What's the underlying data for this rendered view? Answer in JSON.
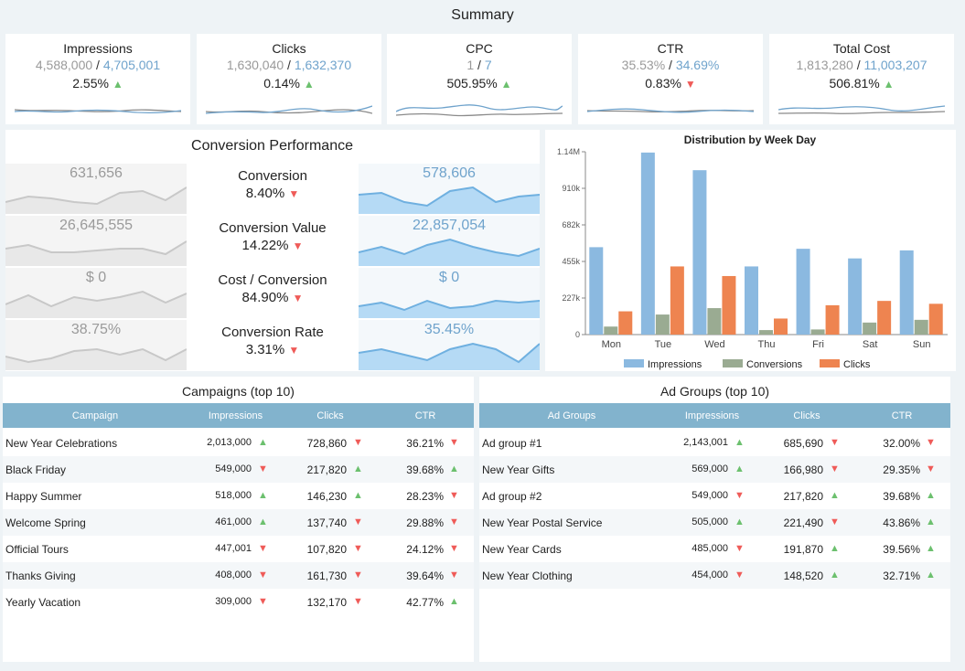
{
  "page_title": "Summary",
  "kpis": [
    {
      "name": "Impressions",
      "prev": "4,588,000",
      "cur": "4,705,001",
      "pct": "2.55%",
      "dir": "up"
    },
    {
      "name": "Clicks",
      "prev": "1,630,040",
      "cur": "1,632,370",
      "pct": "0.14%",
      "dir": "up"
    },
    {
      "name": "CPC",
      "prev": "1",
      "cur": "7",
      "pct": "505.95%",
      "dir": "up"
    },
    {
      "name": "CTR",
      "prev": "35.53%",
      "cur": "34.69%",
      "pct": "0.83%",
      "dir": "down"
    },
    {
      "name": "Total Cost",
      "prev": "1,813,280",
      "cur": "11,003,207",
      "pct": "506.81%",
      "dir": "up"
    }
  ],
  "separator": "/",
  "conversion": {
    "title": "Conversion Performance",
    "rows": [
      {
        "name": "Conversion",
        "left": "631,656",
        "pct": "8.40%",
        "dir": "down",
        "right": "578,606"
      },
      {
        "name": "Conversion Value",
        "left": "26,645,555",
        "pct": "14.22%",
        "dir": "down",
        "right": "22,857,054"
      },
      {
        "name": "Cost / Conversion",
        "left": "$ 0",
        "pct": "84.90%",
        "dir": "down",
        "right": "$ 0"
      },
      {
        "name": "Conversion Rate",
        "left": "38.75%",
        "pct": "3.31%",
        "dir": "down",
        "right": "35.45%"
      }
    ]
  },
  "chart_data": {
    "type": "bar",
    "title": "Distribution by Week Day",
    "categories": [
      "Mon",
      "Tue",
      "Wed",
      "Thu",
      "Fri",
      "Sat",
      "Sun"
    ],
    "series": [
      {
        "name": "Impressions",
        "color": "#8bb9e0",
        "values": [
          545000,
          1135000,
          1025000,
          425000,
          535000,
          475000,
          525000
        ]
      },
      {
        "name": "Conversions",
        "color": "#9aab92",
        "values": [
          50000,
          125000,
          165000,
          28000,
          32000,
          75000,
          92000
        ]
      },
      {
        "name": "Clicks",
        "color": "#ee8450",
        "values": [
          145000,
          425000,
          365000,
          100000,
          183000,
          210000,
          192000
        ]
      }
    ],
    "yticks": [
      "0",
      "227k",
      "455k",
      "682k",
      "910k",
      "1.14M"
    ],
    "ylim": [
      0,
      1140000
    ],
    "legend": "bottom"
  },
  "campaigns": {
    "title": "Campaigns (top 10)",
    "headers": [
      "Campaign",
      "Impressions",
      "Clicks",
      "CTR"
    ],
    "rows": [
      {
        "name": "New Year Celebrations",
        "imp": "2,013,000",
        "imp_dir": "up",
        "clicks": "728,860",
        "clicks_dir": "down",
        "ctr": "36.21%",
        "ctr_dir": "down"
      },
      {
        "name": "Black Friday",
        "imp": "549,000",
        "imp_dir": "down",
        "clicks": "217,820",
        "clicks_dir": "up",
        "ctr": "39.68%",
        "ctr_dir": "up"
      },
      {
        "name": "Happy Summer",
        "imp": "518,000",
        "imp_dir": "up",
        "clicks": "146,230",
        "clicks_dir": "up",
        "ctr": "28.23%",
        "ctr_dir": "down"
      },
      {
        "name": "Welcome Spring",
        "imp": "461,000",
        "imp_dir": "up",
        "clicks": "137,740",
        "clicks_dir": "down",
        "ctr": "29.88%",
        "ctr_dir": "down"
      },
      {
        "name": "Official Tours",
        "imp": "447,001",
        "imp_dir": "down",
        "clicks": "107,820",
        "clicks_dir": "down",
        "ctr": "24.12%",
        "ctr_dir": "down"
      },
      {
        "name": "Thanks Giving",
        "imp": "408,000",
        "imp_dir": "down",
        "clicks": "161,730",
        "clicks_dir": "down",
        "ctr": "39.64%",
        "ctr_dir": "down"
      },
      {
        "name": "Yearly Vacation",
        "imp": "309,000",
        "imp_dir": "down",
        "clicks": "132,170",
        "clicks_dir": "down",
        "ctr": "42.77%",
        "ctr_dir": "up"
      }
    ]
  },
  "adgroups": {
    "title": "Ad Groups (top 10)",
    "headers": [
      "Ad Groups",
      "Impressions",
      "Clicks",
      "CTR"
    ],
    "rows": [
      {
        "name": "Ad group #1",
        "imp": "2,143,001",
        "imp_dir": "up",
        "clicks": "685,690",
        "clicks_dir": "down",
        "ctr": "32.00%",
        "ctr_dir": "down"
      },
      {
        "name": "New Year Gifts",
        "imp": "569,000",
        "imp_dir": "up",
        "clicks": "166,980",
        "clicks_dir": "down",
        "ctr": "29.35%",
        "ctr_dir": "down"
      },
      {
        "name": "Ad group #2",
        "imp": "549,000",
        "imp_dir": "down",
        "clicks": "217,820",
        "clicks_dir": "up",
        "ctr": "39.68%",
        "ctr_dir": "up"
      },
      {
        "name": "New Year Postal Service",
        "imp": "505,000",
        "imp_dir": "up",
        "clicks": "221,490",
        "clicks_dir": "down",
        "ctr": "43.86%",
        "ctr_dir": "up"
      },
      {
        "name": "New Year Cards",
        "imp": "485,000",
        "imp_dir": "down",
        "clicks": "191,870",
        "clicks_dir": "up",
        "ctr": "39.56%",
        "ctr_dir": "up"
      },
      {
        "name": "New Year Clothing",
        "imp": "454,000",
        "imp_dir": "down",
        "clicks": "148,520",
        "clicks_dir": "up",
        "ctr": "32.71%",
        "ctr_dir": "up"
      }
    ]
  },
  "colors": {
    "up": "#6cc06e",
    "down": "#ef5b58",
    "header": "#82b3cd",
    "current": "#6fa3cc",
    "previous": "#9a9a9a"
  }
}
